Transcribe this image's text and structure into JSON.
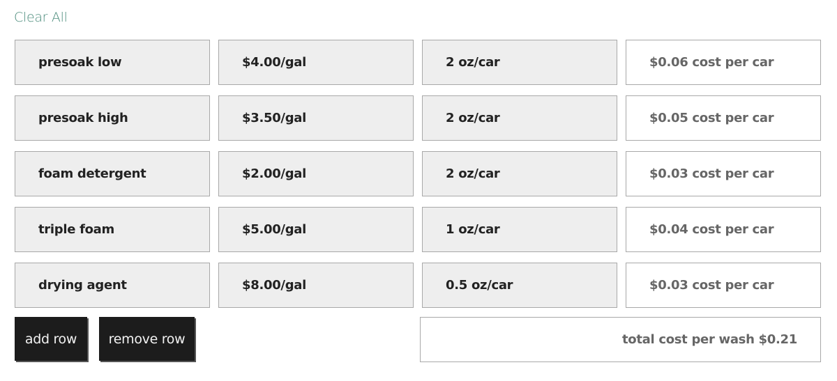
{
  "clear_all_label": "Clear All",
  "rows": [
    {
      "name": "presoak low",
      "price": "$4.00/gal",
      "usage": "2 oz/car",
      "cost": "$0.06 cost per car"
    },
    {
      "name": "presoak high",
      "price": "$3.50/gal",
      "usage": "2 oz/car",
      "cost": "$0.05 cost per car"
    },
    {
      "name": "foam detergent",
      "price": "$2.00/gal",
      "usage": "2 oz/car",
      "cost": "$0.03 cost per car"
    },
    {
      "name": "triple foam",
      "price": "$5.00/gal",
      "usage": "1 oz/car",
      "cost": "$0.04 cost per car"
    },
    {
      "name": "drying agent",
      "price": "$8.00/gal",
      "usage": "0.5 oz/car",
      "cost": "$0.03 cost per car"
    }
  ],
  "buttons": {
    "add_row": "add row",
    "remove_row": "remove row"
  },
  "total": "total cost per wash $0.21",
  "colors": {
    "link": "#4c8c7c",
    "button_bg": "#1c1c1c",
    "field_bg": "#eeeeee"
  }
}
